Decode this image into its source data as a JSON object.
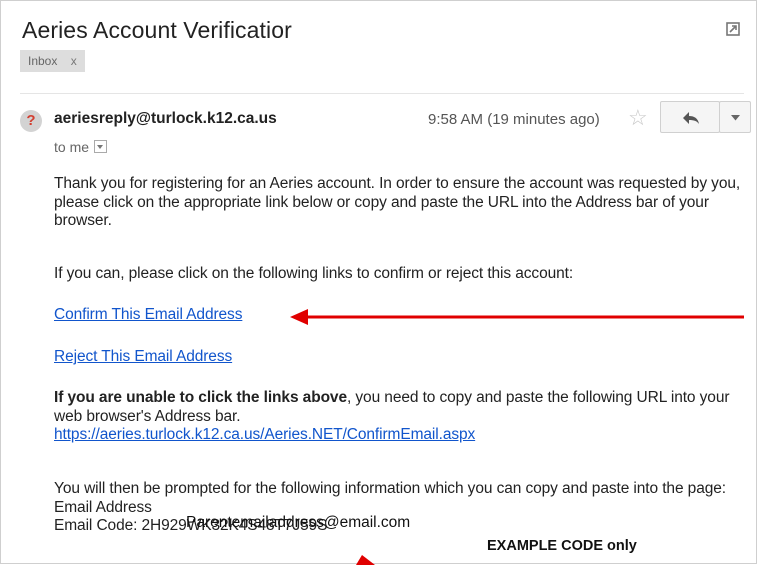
{
  "email": {
    "subject": "Aeries Account Verificatior",
    "label": "Inbox",
    "label_remove": "x",
    "sender": "aeriesreply@turlock.k12.ca.us",
    "time": "9:58 AM (19 minutes ago)",
    "recipient": "to me",
    "body": {
      "para1": "Thank you for registering for an Aeries account. In order to ensure the account was requested by you, please click on the appropriate link below or copy and paste the URL into the Address bar of your browser.",
      "para2": "If you can, please click on the following links to confirm or reject this account:",
      "confirm_link": "Confirm This Email Address",
      "reject_link": "Reject This Email Address",
      "unable_bold": "If you are unable to click the links above",
      "unable_rest": ", you need to copy and paste the following URL into your web browser's Address bar.",
      "url": "https://aeries.turlock.k12.ca.us/Aeries.NET/ConfirmEmail.aspx",
      "prompt": "You will then be prompted for the following information which you can copy and paste into the page:",
      "email_address_label": "Email Address",
      "email_code": "Email Code: 2H929WK32K4S48T7J59S"
    }
  },
  "annotations": {
    "email_overlay": "Parentemailaddress@email.com",
    "example_note": "EXAMPLE CODE only",
    "arrow_color": "#e00000"
  },
  "icons": [
    "popout-icon",
    "unknown-sender-icon",
    "star-icon",
    "reply-icon",
    "more-options-icon",
    "details-caret-icon"
  ]
}
